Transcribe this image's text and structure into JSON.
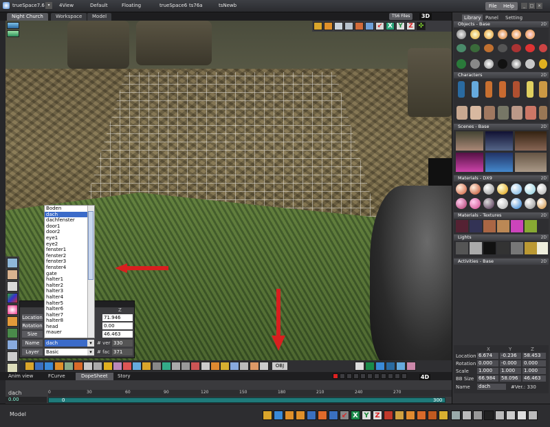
{
  "window": {
    "app_title": "trueSpace7.6",
    "menu": [
      "File",
      "Help"
    ],
    "top_tabs": [
      "4View",
      "Default",
      "Floating",
      "trueSpace6",
      "ts76a",
      "tsNewb"
    ]
  },
  "workspace_tabs": [
    "Night Church",
    "Workspace",
    "Model"
  ],
  "viewport": {
    "ts6_files_label": "TS6 Files",
    "mode_label": "3D",
    "toolbar_letters": [
      "X",
      "Y",
      "Z"
    ]
  },
  "object_list": {
    "items": [
      "Boden",
      "dach",
      "dachfenster",
      "door1",
      "door2",
      "eye1",
      "eye2",
      "fenster1",
      "fenster2",
      "fenster3",
      "fenster4",
      "gate",
      "halter1",
      "halter2",
      "halter3",
      "halter4",
      "halter5",
      "halter6",
      "halter7",
      "halter8",
      "head",
      "mauer"
    ],
    "selected": "dach"
  },
  "properties": {
    "col_header": "Z",
    "rows": [
      {
        "label": "Location",
        "value": "71.946"
      },
      {
        "label": "Rotation",
        "value": "0.00"
      },
      {
        "label": "Size",
        "value": "46.463"
      }
    ],
    "name_label": "Name",
    "name_value": "dach",
    "ver_label": "# ver",
    "ver_value": "330",
    "layer_label": "Layer",
    "layer_value": "Basic",
    "fac_label": "# fac",
    "fac_value": "371"
  },
  "bottom_toolbar": {
    "obj_label": "OBJ"
  },
  "anim": {
    "tabs": [
      "Anim view",
      "FCurve",
      "DopeSheet",
      "Story"
    ],
    "mode_label": "4D",
    "object_name": "dach",
    "time": "0.00",
    "ruler_ticks": [
      "0",
      "30",
      "60",
      "90",
      "120",
      "150",
      "180",
      "210",
      "240",
      "270"
    ],
    "range_start": "0",
    "range_end": "300"
  },
  "status": {
    "text": "Model"
  },
  "right_panel": {
    "tabs": [
      "Library",
      "Panel",
      "Setting"
    ],
    "sections": [
      {
        "title": "Objects - Base",
        "ctl": "2D"
      },
      {
        "title": "Characters",
        "ctl": "2D"
      },
      {
        "title": "Scenes - Base",
        "ctl": "2D"
      },
      {
        "title": "Materials - DX9",
        "ctl": "2D"
      },
      {
        "title": "Materials - Textures",
        "ctl": "2D"
      },
      {
        "title": "Lights",
        "ctl": "2D"
      },
      {
        "title": "Activities - Base",
        "ctl": "2D"
      }
    ],
    "info": {
      "headers": [
        "X",
        "Y",
        "Z"
      ],
      "rows": [
        {
          "label": "Location",
          "values": [
            "6.674",
            "-0.236",
            "58.453"
          ]
        },
        {
          "label": "Rotation",
          "values": [
            "0.000",
            "-0.000",
            "0.000"
          ]
        },
        {
          "label": "Scale",
          "values": [
            "1.000",
            "1.000",
            "1.000"
          ]
        },
        {
          "label": "BB Size",
          "values": [
            "66.984",
            "58.096",
            "46.463"
          ]
        }
      ],
      "name_label": "Name",
      "name_value": "dach",
      "ver_text": "#Ver.: 330"
    }
  },
  "colors": {
    "accent_red": "#d91f1f",
    "selection_blue": "#3b6bc9",
    "timeline_teal": "#1f7a7a"
  }
}
